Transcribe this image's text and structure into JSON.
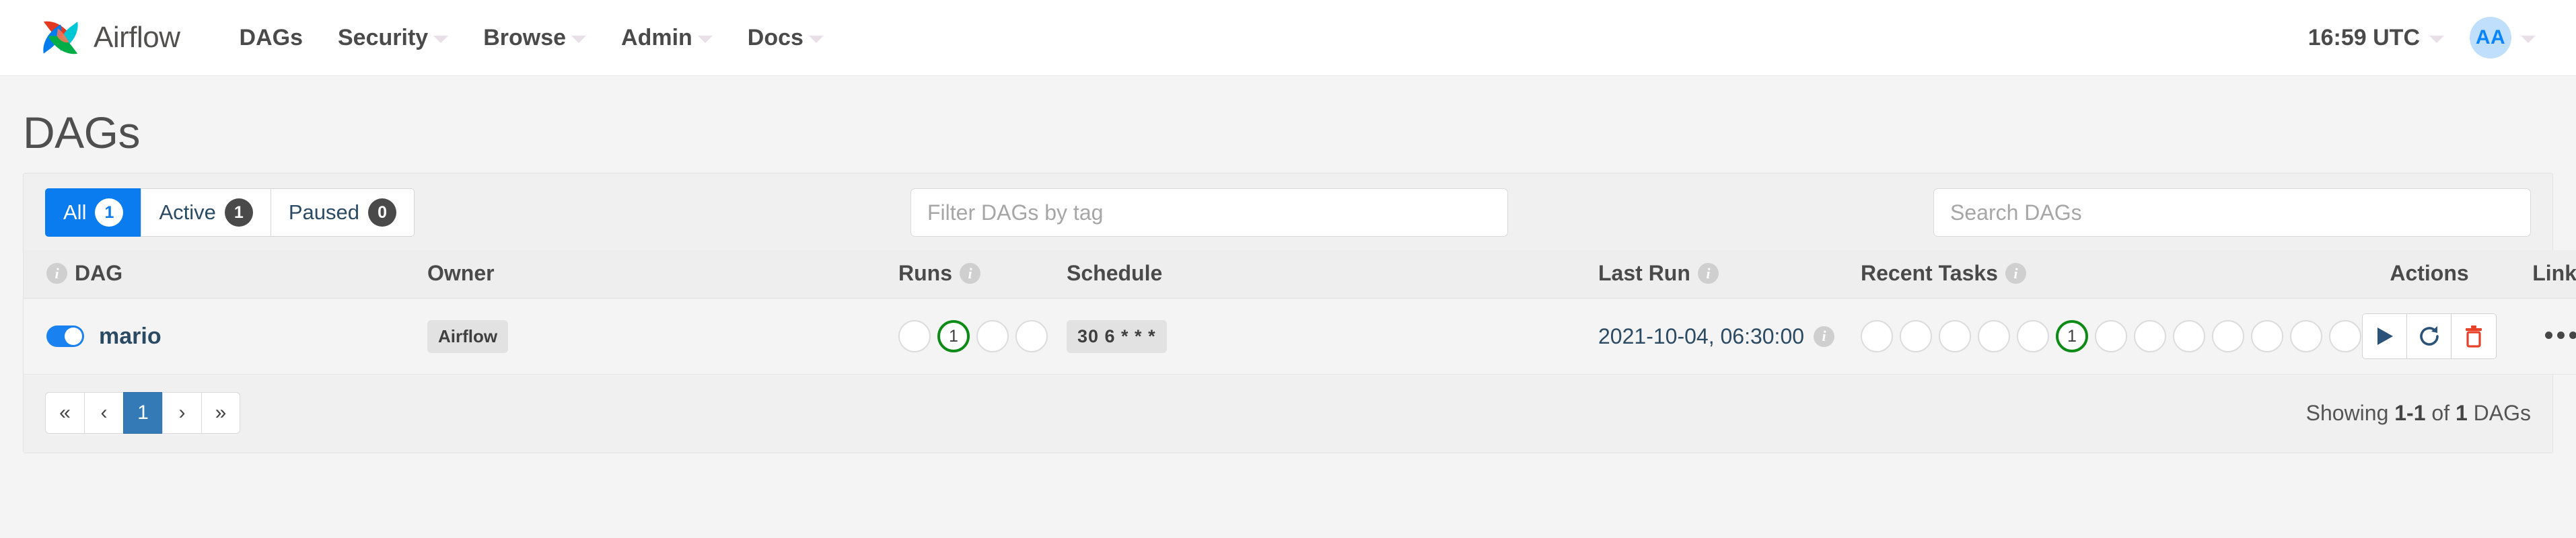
{
  "navbar": {
    "brand": "Airflow",
    "logo_colors": {
      "red": "#E43921",
      "cyan": "#00C7D4",
      "blue": "#017CEE",
      "green": "#00AD46",
      "salmon": "#FF7557"
    },
    "links": [
      {
        "label": "DAGs",
        "has_caret": false
      },
      {
        "label": "Security",
        "has_caret": true
      },
      {
        "label": "Browse",
        "has_caret": true
      },
      {
        "label": "Admin",
        "has_caret": true
      },
      {
        "label": "Docs",
        "has_caret": true
      }
    ],
    "time": "16:59 UTC",
    "user_initials": "AA"
  },
  "page": {
    "title": "DAGs"
  },
  "filters": {
    "buttons": [
      {
        "label": "All",
        "count": "1",
        "active": true
      },
      {
        "label": "Active",
        "count": "1",
        "active": false
      },
      {
        "label": "Paused",
        "count": "0",
        "active": false
      }
    ],
    "tag_placeholder": "Filter DAGs by tag",
    "tag_value": "",
    "search_placeholder": "Search DAGs",
    "search_value": ""
  },
  "table": {
    "headers": {
      "dag": "DAG",
      "owner": "Owner",
      "runs": "Runs",
      "schedule": "Schedule",
      "last_run": "Last Run",
      "recent_tasks": "Recent Tasks",
      "actions": "Actions",
      "links": "Links"
    },
    "rows": [
      {
        "enabled": true,
        "name": "mario",
        "owner": "Airflow",
        "runs": [
          {
            "state": "none",
            "count": ""
          },
          {
            "state": "success",
            "count": "1"
          },
          {
            "state": "none",
            "count": ""
          },
          {
            "state": "none",
            "count": ""
          }
        ],
        "schedule": "30 6 * * *",
        "last_run": "2021-10-04, 06:30:00",
        "recent_tasks": [
          {
            "state": "none",
            "count": ""
          },
          {
            "state": "none",
            "count": ""
          },
          {
            "state": "none",
            "count": ""
          },
          {
            "state": "none",
            "count": ""
          },
          {
            "state": "none",
            "count": ""
          },
          {
            "state": "success",
            "count": "1"
          },
          {
            "state": "none",
            "count": ""
          },
          {
            "state": "none",
            "count": ""
          },
          {
            "state": "none",
            "count": ""
          },
          {
            "state": "none",
            "count": ""
          },
          {
            "state": "none",
            "count": ""
          },
          {
            "state": "none",
            "count": ""
          },
          {
            "state": "none",
            "count": ""
          }
        ],
        "actions": [
          {
            "name": "trigger-dag",
            "icon": "play-icon",
            "color": "#2b5278"
          },
          {
            "name": "refresh-dag",
            "icon": "refresh-icon",
            "color": "#2b5278"
          },
          {
            "name": "delete-dag",
            "icon": "trash-icon",
            "color": "#e8412a"
          }
        ],
        "links_icon": "ellipsis-icon"
      }
    ]
  },
  "footer": {
    "pagination": [
      {
        "label": "«",
        "name": "first-page",
        "active": false
      },
      {
        "label": "‹",
        "name": "prev-page",
        "active": false
      },
      {
        "label": "1",
        "name": "page-1",
        "active": true
      },
      {
        "label": "›",
        "name": "next-page",
        "active": false
      },
      {
        "label": "»",
        "name": "last-page",
        "active": false
      }
    ],
    "showing_prefix": "Showing ",
    "showing_range": "1-1",
    "showing_mid": " of ",
    "showing_total": "1",
    "showing_suffix": " DAGs"
  },
  "colors": {
    "accent_blue": "#0a7cf0",
    "pagination_blue": "#337ab7",
    "success_green": "#0e8a16",
    "danger_red": "#e8412a",
    "link_navy": "#2b4a63"
  }
}
